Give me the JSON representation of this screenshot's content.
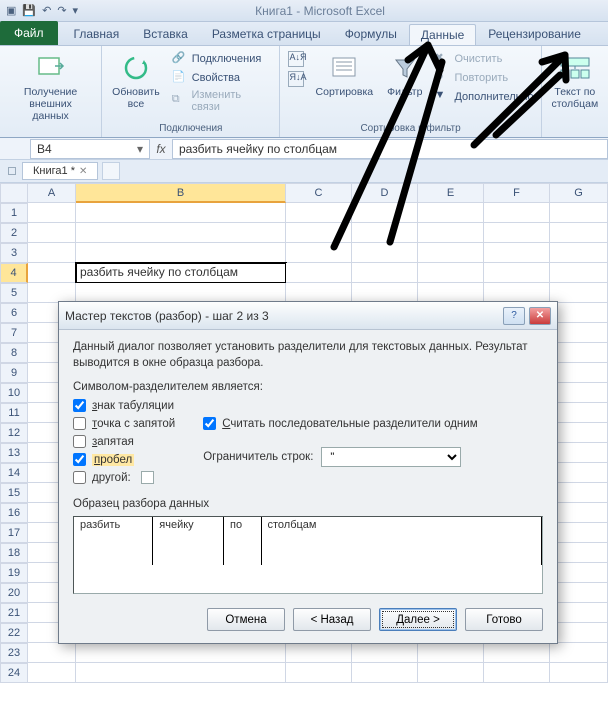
{
  "app": {
    "title": "Книга1 - Microsoft Excel",
    "qat": {
      "save": "💾",
      "undo": "↶",
      "redo": "↷",
      "more": "▾"
    }
  },
  "tabs": {
    "file": "Файл",
    "items": [
      "Главная",
      "Вставка",
      "Разметка страницы",
      "Формулы",
      "Данные",
      "Рецензирование"
    ],
    "active": "Данные"
  },
  "ribbon": {
    "group_ext": {
      "get_ext": "Получение\nвнешних данных",
      "refresh": "Обновить\nвсе",
      "connections": "Подключения",
      "properties": "Свойства",
      "edit_links": "Изменить связи",
      "label": "Подключения"
    },
    "group_sort": {
      "az": "А↓Я",
      "za": "Я↓А",
      "sort": "Сортировка",
      "filter": "Фильтр",
      "clear": "Очистить",
      "reapply": "Повторить",
      "advanced": "Дополнительно",
      "label": "Сортировка и фильтр"
    },
    "group_tools": {
      "text_to_cols": "Текст по\nстолбцам"
    }
  },
  "namebox": "B4",
  "formula": "разбить ячейку по столбцам",
  "workbook_tab": "Книга1 *",
  "columns": [
    "A",
    "B",
    "C",
    "D",
    "E",
    "F",
    "G"
  ],
  "active_col": "B",
  "active_row": 4,
  "cell_B4": "разбить ячейку по столбцам",
  "dialog": {
    "title": "Мастер текстов (разбор) - шаг 2 из 3",
    "intro": "Данный диалог позволяет установить разделители для текстовых данных. Результат выводится в окне образца разбора.",
    "delims_label": "Символом-разделителем является:",
    "tab": "знак табуляции",
    "semicolon": "точка с запятой",
    "comma": "запятая",
    "space": "пробел",
    "other": "другой:",
    "consecutive": "Считать последовательные разделители одним",
    "qualifier_label": "Ограничитель строк:",
    "qualifier_value": "\"",
    "preview_label": "Образец разбора данных",
    "preview_cells": [
      "разбить",
      "ячейку",
      "по",
      "столбцам"
    ],
    "btn_cancel": "Отмена",
    "btn_back": "< Назад",
    "btn_next": "Далее >",
    "btn_finish": "Готово",
    "checked": {
      "tab": true,
      "semicolon": false,
      "comma": false,
      "space": true,
      "other": false,
      "consecutive": true
    }
  }
}
